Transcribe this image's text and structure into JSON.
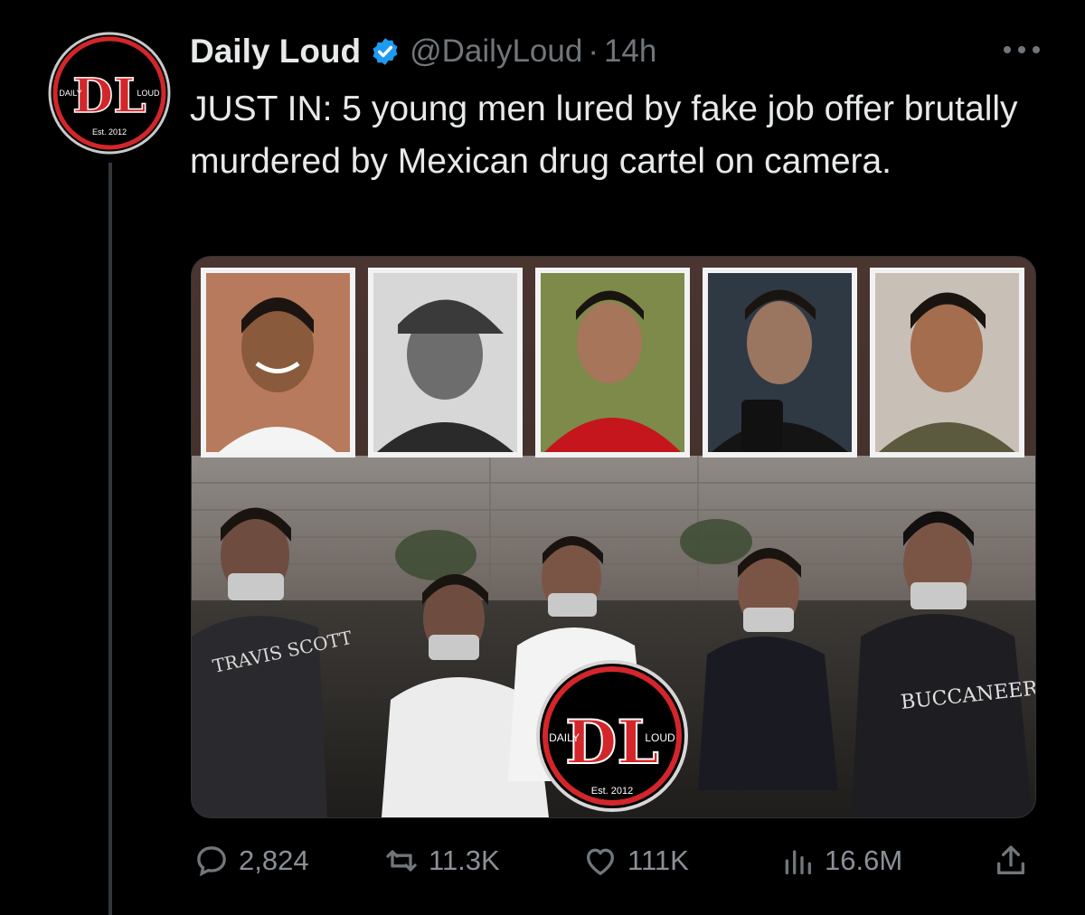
{
  "tweet": {
    "author_name": "Daily Loud",
    "handle": "@DailyLoud",
    "separator": "·",
    "time": "14h",
    "text": "JUST IN: 5 young men lured by fake job offer brutally murdered by Mexican drug cartel on camera.",
    "verified": true
  },
  "avatar_logo": {
    "letters": "DL",
    "left_word": "DAILY",
    "right_word": "LOUD",
    "est": "Est. 2012"
  },
  "media": {
    "watermark": {
      "letters": "DL",
      "left_word": "DAILY",
      "right_word": "LOUD",
      "est": "Est. 2012"
    },
    "shirt_texts": [
      "TRAVIS SCOTT",
      "BUCCANEER"
    ]
  },
  "actions": {
    "replies": "2,824",
    "reposts": "11.3K",
    "likes": "111K",
    "views": "16.6M"
  },
  "icons": {
    "reply": "speech-bubble-icon",
    "repost": "repost-arrows-icon",
    "like": "heart-icon",
    "views": "bar-chart-icon",
    "share": "share-upload-icon",
    "more": "ellipsis-icon",
    "verified": "verified-badge-icon"
  },
  "colors": {
    "background": "#000000",
    "text_primary": "#e7e9ea",
    "text_secondary": "#71767b",
    "verified_blue": "#1d9bf0",
    "logo_red": "#d3262a"
  }
}
